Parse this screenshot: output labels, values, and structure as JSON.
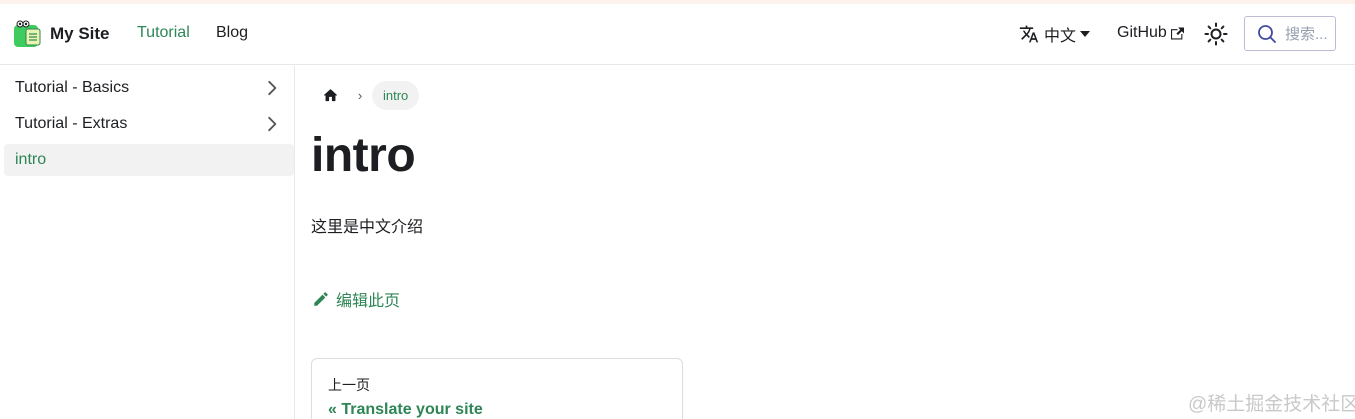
{
  "navbar": {
    "brand_title": "My Site",
    "links": [
      "Tutorial",
      "Blog"
    ],
    "active_link": "Tutorial",
    "language": "中文",
    "github": "GitHub",
    "search_placeholder": "搜索..."
  },
  "sidebar": {
    "items": [
      {
        "label": "Tutorial - Basics",
        "expandable": true
      },
      {
        "label": "Tutorial - Extras",
        "expandable": true
      },
      {
        "label": "intro",
        "active": true
      }
    ]
  },
  "breadcrumb": {
    "current": "intro"
  },
  "main": {
    "title": "intro",
    "text": "这里是中文介绍",
    "edit_label": "编辑此页"
  },
  "pagination": {
    "previous_sub": "上一页",
    "previous_label": "« Translate your site"
  },
  "watermark": "@稀土掘金技术社区",
  "colors": {
    "accent": "#2e8555",
    "text": "#1c1e21",
    "border": "#dadde1"
  },
  "icons": [
    "logo-icon",
    "translate-icon",
    "external-link-icon",
    "sun-icon",
    "search-icon",
    "chevron-right-icon",
    "home-icon",
    "pencil-icon"
  ]
}
